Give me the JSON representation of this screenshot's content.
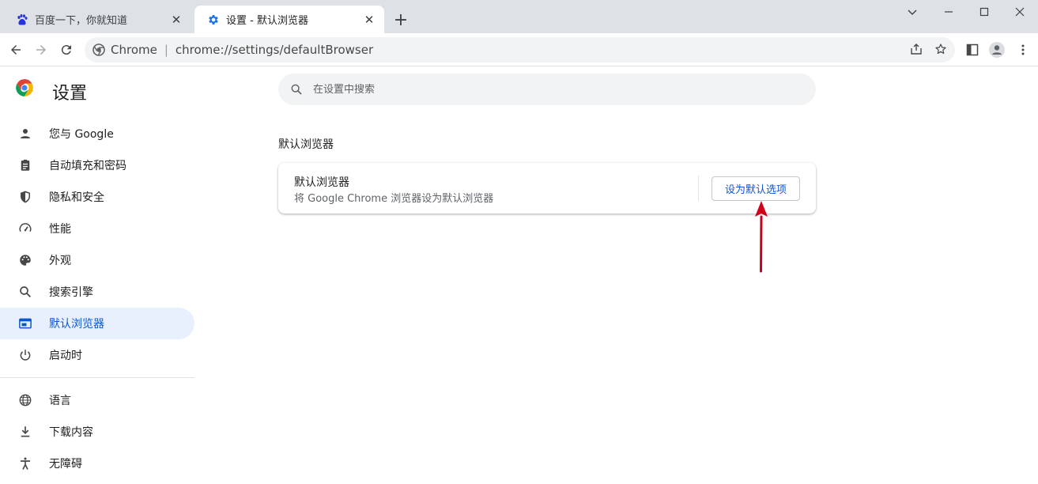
{
  "browser": {
    "tabs": [
      {
        "title": "百度一下，你就知道",
        "icon": "baidu-paw-icon",
        "active": false
      },
      {
        "title": "设置 - 默认浏览器",
        "icon": "gear-icon",
        "active": true
      }
    ],
    "omnibox": {
      "chip": "Chrome",
      "url": "chrome://settings/defaultBrowser"
    }
  },
  "settings": {
    "title": "设置",
    "search_placeholder": "在设置中搜索",
    "nav": [
      {
        "label": "您与 Google",
        "icon": "person-icon"
      },
      {
        "label": "自动填充和密码",
        "icon": "clipboard-icon"
      },
      {
        "label": "隐私和安全",
        "icon": "shield-icon"
      },
      {
        "label": "性能",
        "icon": "speedometer-icon"
      },
      {
        "label": "外观",
        "icon": "palette-icon"
      },
      {
        "label": "搜索引擎",
        "icon": "search-icon"
      },
      {
        "label": "默认浏览器",
        "icon": "browser-window-icon",
        "active": true
      },
      {
        "label": "启动时",
        "icon": "power-icon"
      },
      {
        "label": "语言",
        "icon": "globe-icon"
      },
      {
        "label": "下载内容",
        "icon": "download-icon"
      },
      {
        "label": "无障碍",
        "icon": "accessibility-icon"
      }
    ],
    "section_title": "默认浏览器",
    "card": {
      "label": "默认浏览器",
      "sublabel": "将 Google Chrome 浏览器设为默认浏览器",
      "button": "设为默认选项"
    }
  },
  "colors": {
    "accent": "#0b57d0",
    "active_nav_bg": "#e8f0fe",
    "annotation_arrow": "#d0021b"
  }
}
